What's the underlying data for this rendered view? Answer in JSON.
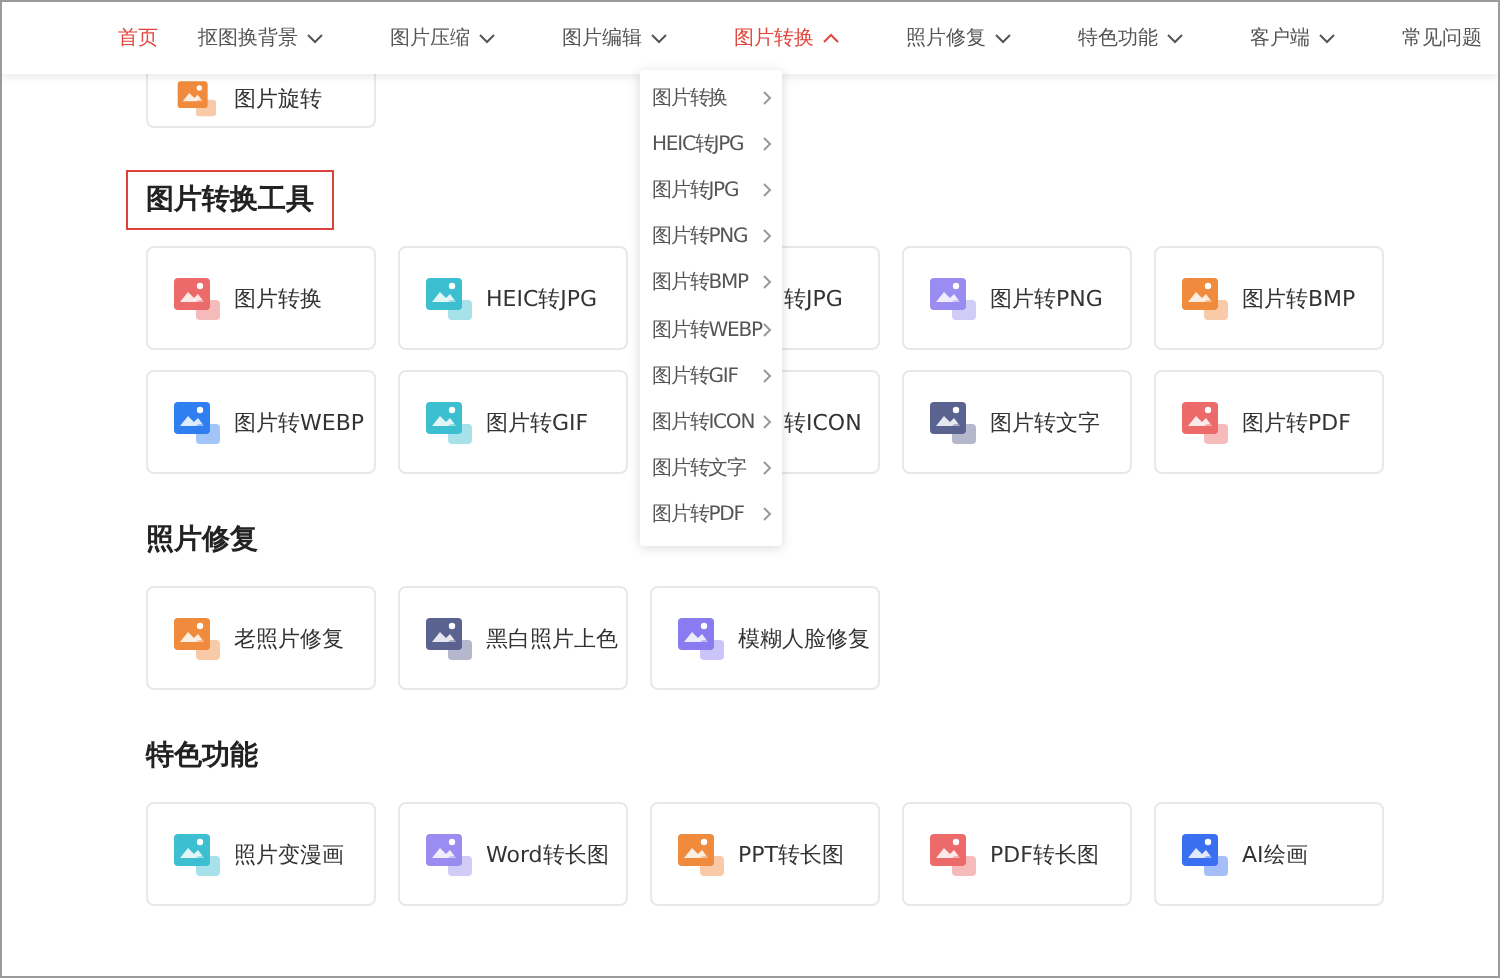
{
  "nav": [
    {
      "label": "首页",
      "selected": true,
      "dropdown": false
    },
    {
      "label": "抠图换背景",
      "selected": false,
      "dropdown": true,
      "expanded": false
    },
    {
      "label": "图片压缩",
      "selected": false,
      "dropdown": true,
      "expanded": false
    },
    {
      "label": "图片编辑",
      "selected": false,
      "dropdown": true,
      "expanded": false
    },
    {
      "label": "图片转换",
      "selected": true,
      "dropdown": true,
      "expanded": true
    },
    {
      "label": "照片修复",
      "selected": false,
      "dropdown": true,
      "expanded": false
    },
    {
      "label": "特色功能",
      "selected": false,
      "dropdown": true,
      "expanded": false
    },
    {
      "label": "客户端",
      "selected": false,
      "dropdown": true,
      "expanded": false
    },
    {
      "label": "常见问题",
      "selected": false,
      "dropdown": false
    }
  ],
  "menu": [
    "图片转换",
    "HEIC转JPG",
    "图片转JPG",
    "图片转PNG",
    "图片转BMP",
    "图片转WEBP",
    "图片转GIF",
    "图片转ICON",
    "图片转文字",
    "图片转PDF"
  ],
  "top_card": {
    "label": "图片旋转",
    "color": "#f08a3c"
  },
  "sections": [
    {
      "title": "图片转换工具",
      "highlighted": true,
      "cards": [
        {
          "label": "图片转换",
          "color": "#ec6a6a"
        },
        {
          "label": "HEIC转JPG",
          "color": "#3cbfd0"
        },
        {
          "label": "转JPG",
          "covered": true
        },
        {
          "label": "图片转PNG",
          "color": "#9a8cf0"
        },
        {
          "label": "图片转BMP",
          "color": "#f08a3c"
        },
        {
          "label": "图片转WEBP",
          "color": "#2f7ff0"
        },
        {
          "label": "图片转GIF",
          "color": "#3cbfd0"
        },
        {
          "label": "转ICON",
          "covered": true
        },
        {
          "label": "图片转文字",
          "color": "#5a6290"
        },
        {
          "label": "图片转PDF",
          "color": "#ec6a6a"
        }
      ]
    },
    {
      "title": "照片修复",
      "highlighted": false,
      "cards": [
        {
          "label": "老照片修复",
          "color": "#f08a3c"
        },
        {
          "label": "黑白照片上色",
          "color": "#5a6290"
        },
        {
          "label": "模糊人脸修复",
          "color": "#8a7cf0"
        }
      ]
    },
    {
      "title": "特色功能",
      "highlighted": false,
      "cards": [
        {
          "label": "照片变漫画",
          "color": "#3cbfd0"
        },
        {
          "label": "Word转长图",
          "color": "#9a8cf0"
        },
        {
          "label": "PPT转长图",
          "color": "#f08a3c"
        },
        {
          "label": "PDF转长图",
          "color": "#ec6a6a"
        },
        {
          "label": "AI绘画",
          "color": "#3a6ff0"
        }
      ]
    }
  ]
}
